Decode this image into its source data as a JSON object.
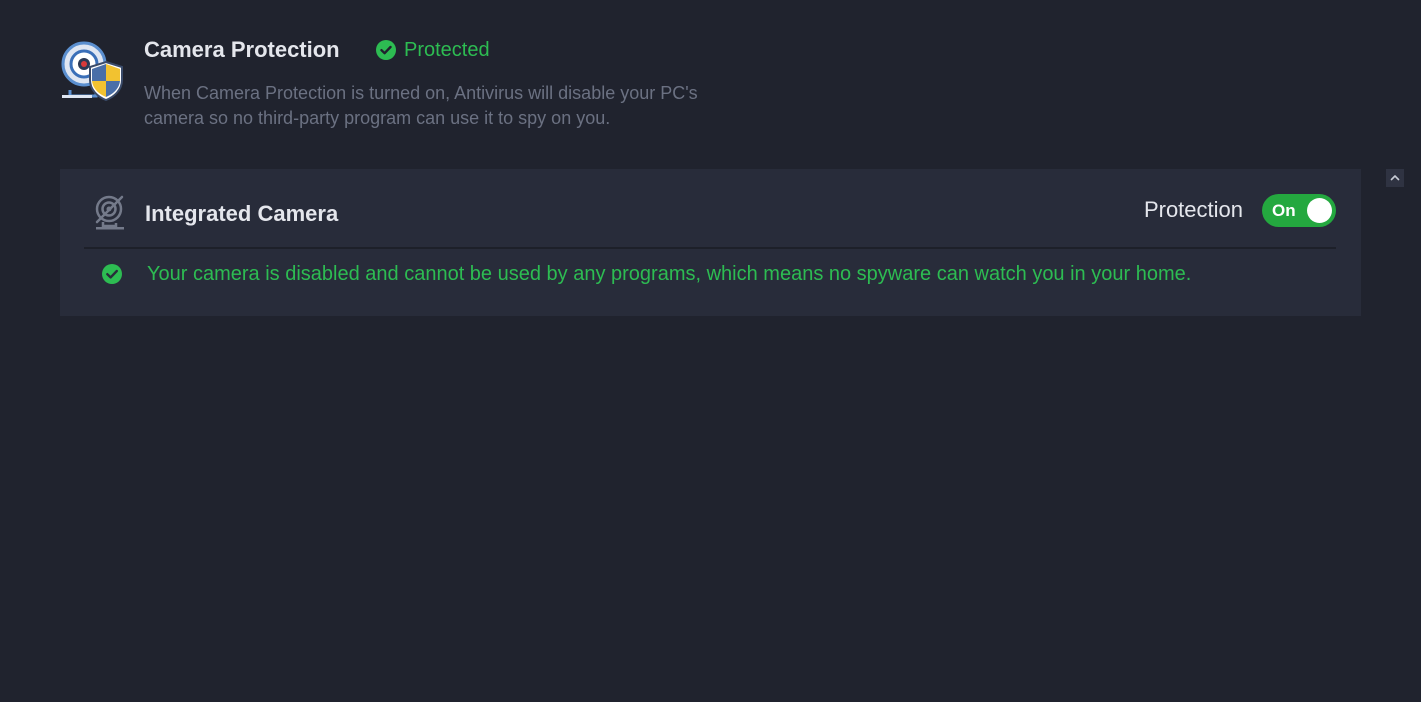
{
  "header": {
    "title": "Camera Protection",
    "status": "Protected",
    "description": "When Camera Protection is turned on, Antivirus will disable your PC's camera so no third-party program can use it to spy on you."
  },
  "device": {
    "name": "Integrated Camera",
    "protection_label": "Protection",
    "toggle_label": "On",
    "toggle_state": true,
    "message": "Your camera is disabled and cannot be used by any programs, which means no spyware can watch you in your home."
  },
  "icons": {
    "header": "camera-shield-icon",
    "status": "check-circle-icon",
    "device": "webcam-disabled-icon",
    "message": "check-circle-icon",
    "collapse": "chevron-up-icon"
  },
  "colors": {
    "background": "#20232e",
    "panel": "#282c3a",
    "success": "#2dbc52",
    "toggle_on": "#24a83f",
    "title": "#e4e6ec",
    "muted": "#6b7182"
  }
}
